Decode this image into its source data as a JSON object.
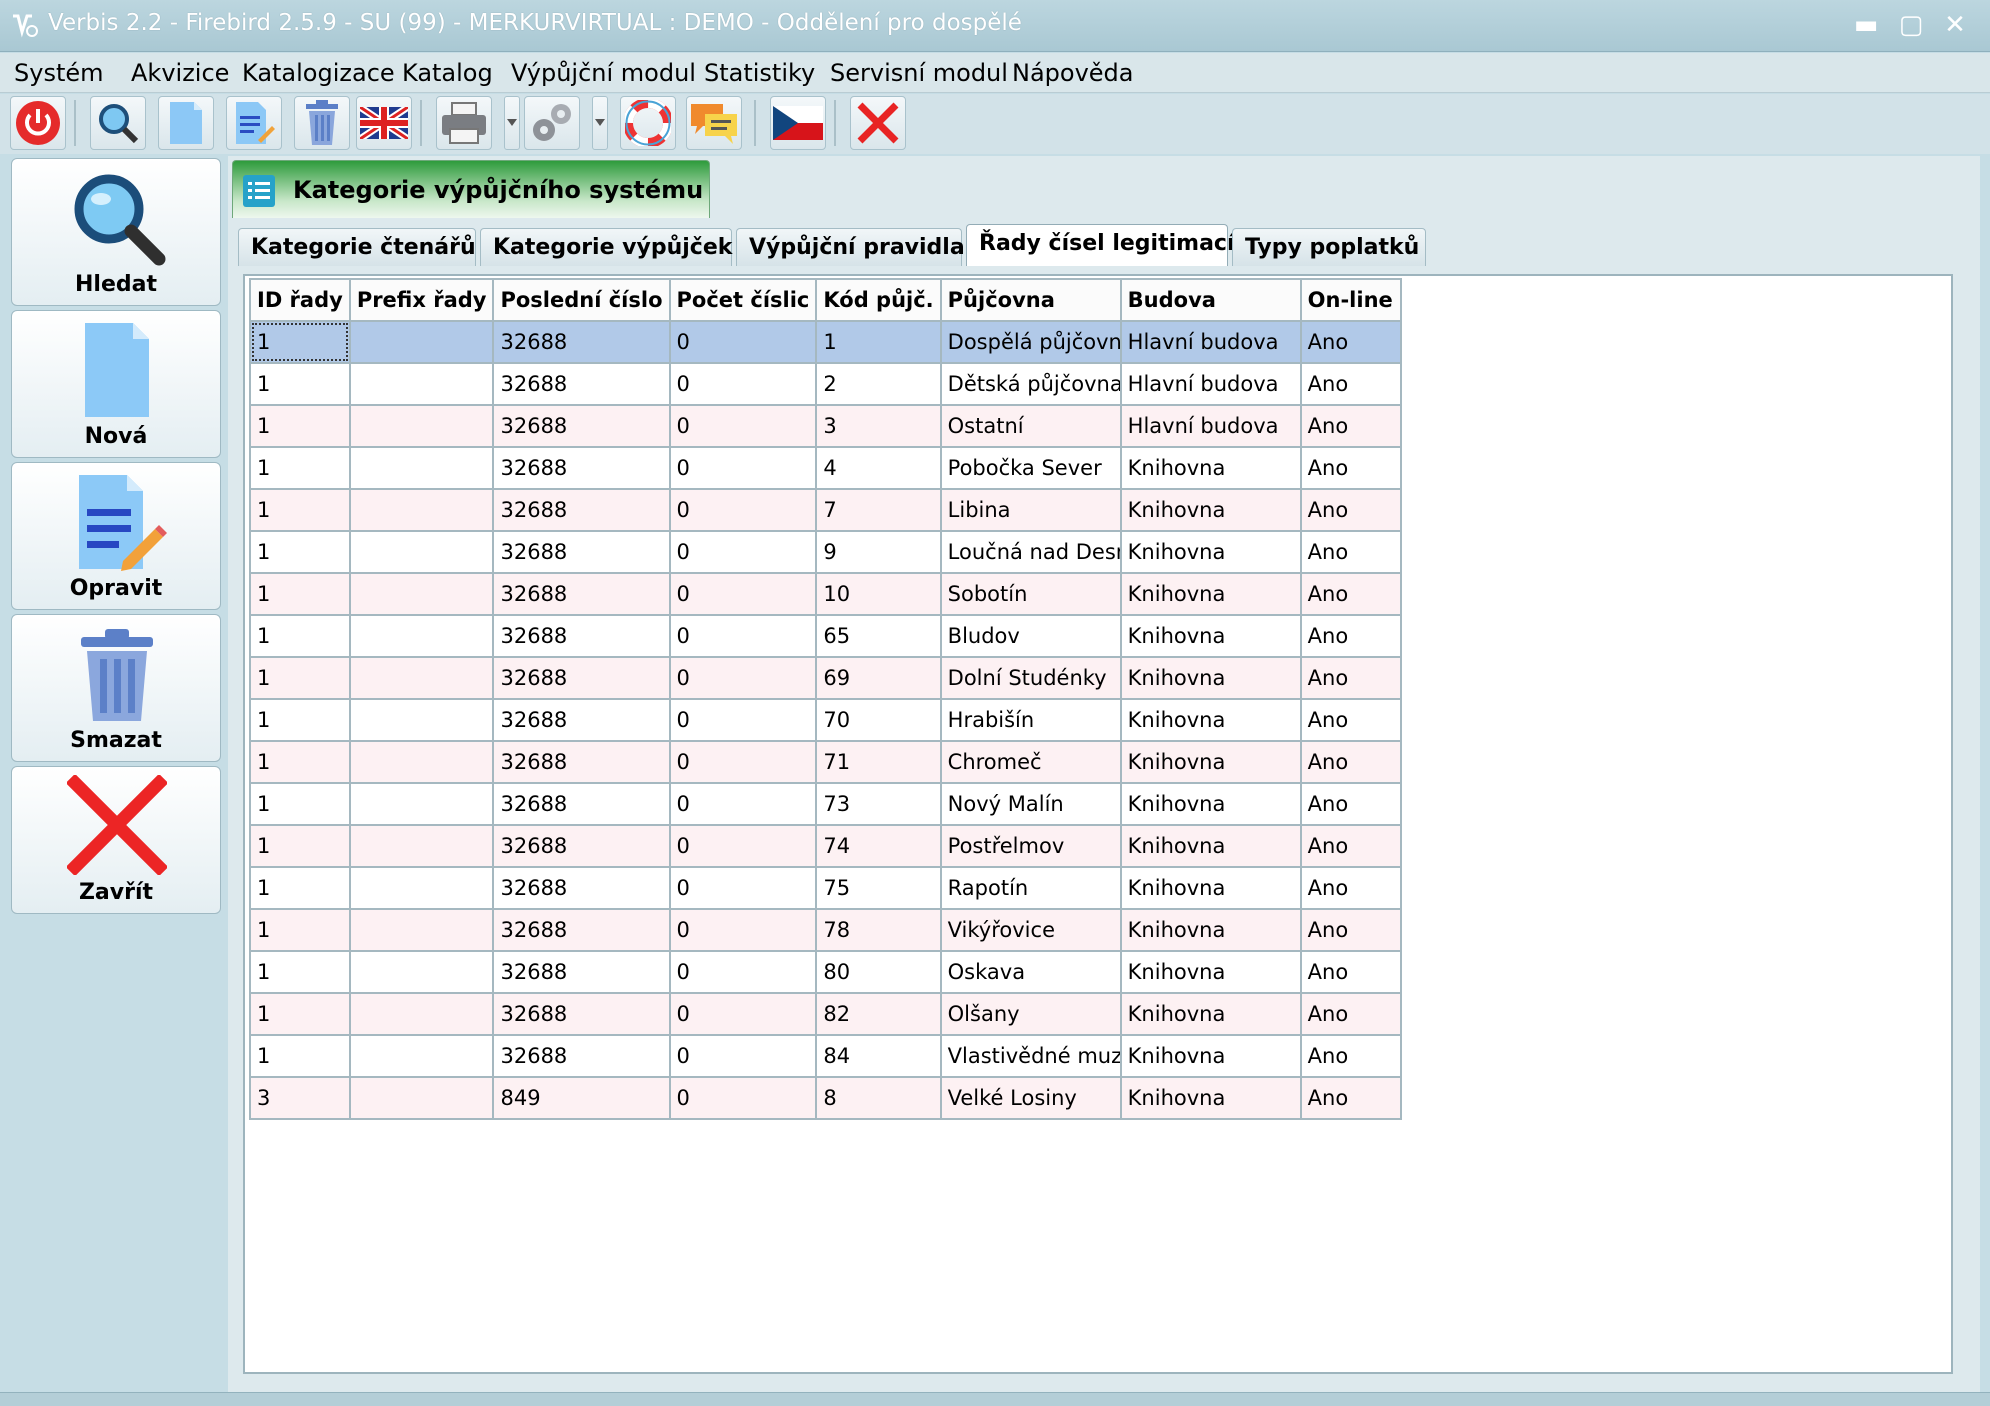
{
  "window": {
    "title": "Verbis 2.2 - Firebird 2.5.9 - SU (99) - MERKURVIRTUAL : DEMO - Oddělení pro dospělé",
    "minimize": "▬",
    "maximize": "▢",
    "close": "✕"
  },
  "menu": [
    "Systém",
    "Akvizice",
    "Katalogizace",
    "Katalog",
    "Výpůjční modul",
    "Statistiky",
    "Servisní modul",
    "Nápověda"
  ],
  "toolbar": {
    "icons": [
      "power-icon",
      "search-icon",
      "new-document-icon",
      "edit-document-icon",
      "trash-icon",
      "uk-flag-icon",
      "printer-icon",
      "settings-gear-icon",
      "lifebuoy-icon",
      "chat-icon",
      "czech-flag-icon",
      "close-red-icon"
    ]
  },
  "sidebar": {
    "search": "Hledat",
    "new": "Nová",
    "edit": "Opravit",
    "delete": "Smazat",
    "close": "Zavřít"
  },
  "header": {
    "title": "Kategorie výpůjčního systému"
  },
  "tabs": [
    "Kategorie čtenářů",
    "Kategorie výpůjček",
    "Výpůjční pravidla",
    "Řady čísel legitimací",
    "Typy poplatků"
  ],
  "active_tab": 3,
  "table": {
    "columns": [
      "ID řady",
      "Prefix řady",
      "Poslední číslo",
      "Počet číslic",
      "Kód půjč.",
      "Půjčovna",
      "Budova",
      "On-line"
    ],
    "rows": [
      [
        "1",
        "",
        "32688",
        "0",
        "1",
        "Dospělá půjčovna",
        "Hlavní budova",
        "Ano"
      ],
      [
        "1",
        "",
        "32688",
        "0",
        "2",
        "Dětská půjčovna",
        "Hlavní budova",
        "Ano"
      ],
      [
        "1",
        "",
        "32688",
        "0",
        "3",
        "Ostatní",
        "Hlavní budova",
        "Ano"
      ],
      [
        "1",
        "",
        "32688",
        "0",
        "4",
        "Pobočka Sever",
        "Knihovna",
        "Ano"
      ],
      [
        "1",
        "",
        "32688",
        "0",
        "7",
        "Libina",
        "Knihovna",
        "Ano"
      ],
      [
        "1",
        "",
        "32688",
        "0",
        "9",
        "Loučná nad Desnou",
        "Knihovna",
        "Ano"
      ],
      [
        "1",
        "",
        "32688",
        "0",
        "10",
        "Sobotín",
        "Knihovna",
        "Ano"
      ],
      [
        "1",
        "",
        "32688",
        "0",
        "65",
        "Bludov",
        "Knihovna",
        "Ano"
      ],
      [
        "1",
        "",
        "32688",
        "0",
        "69",
        "Dolní Studénky",
        "Knihovna",
        "Ano"
      ],
      [
        "1",
        "",
        "32688",
        "0",
        "70",
        "Hrabišín",
        "Knihovna",
        "Ano"
      ],
      [
        "1",
        "",
        "32688",
        "0",
        "71",
        "Chromeč",
        "Knihovna",
        "Ano"
      ],
      [
        "1",
        "",
        "32688",
        "0",
        "73",
        "Nový Malín",
        "Knihovna",
        "Ano"
      ],
      [
        "1",
        "",
        "32688",
        "0",
        "74",
        "Postřelmov",
        "Knihovna",
        "Ano"
      ],
      [
        "1",
        "",
        "32688",
        "0",
        "75",
        "Rapotín",
        "Knihovna",
        "Ano"
      ],
      [
        "1",
        "",
        "32688",
        "0",
        "78",
        "Vikýřovice",
        "Knihovna",
        "Ano"
      ],
      [
        "1",
        "",
        "32688",
        "0",
        "80",
        "Oskava",
        "Knihovna",
        "Ano"
      ],
      [
        "1",
        "",
        "32688",
        "0",
        "82",
        "Olšany",
        "Knihovna",
        "Ano"
      ],
      [
        "1",
        "",
        "32688",
        "0",
        "84",
        "Vlastivědné muzeum",
        "Knihovna",
        "Ano"
      ],
      [
        "3",
        "",
        "849",
        "0",
        "8",
        "Velké Losiny",
        "Knihovna",
        "Ano"
      ]
    ],
    "selected_row": 0
  }
}
